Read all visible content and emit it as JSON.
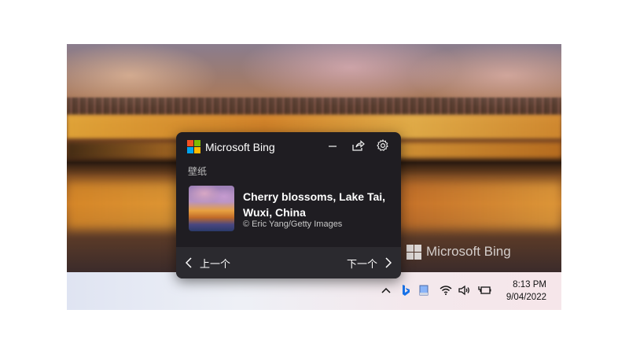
{
  "flyout": {
    "brand": "Microsoft Bing",
    "section_label": "壁纸",
    "title": "Cherry blossoms, Lake Tai, Wuxi, China",
    "credit": "© Eric Yang/Getty Images",
    "prev_label": "上一个",
    "next_label": "下一个",
    "icons": [
      "minimize-icon",
      "share-icon",
      "settings-icon"
    ]
  },
  "watermark": {
    "text": "Microsoft Bing"
  },
  "taskbar": {
    "tray_icons": [
      "chevron-up-icon",
      "bing-icon",
      "note-icon",
      "wifi-icon",
      "volume-icon",
      "battery-icon"
    ],
    "time": "8:13 PM",
    "date": "9/04/2022"
  },
  "colors": {
    "ms_red": "#f25022",
    "ms_green": "#7fba00",
    "ms_blue": "#00a4ef",
    "ms_yellow": "#ffb900",
    "bing_blue": "#1a73e8"
  }
}
